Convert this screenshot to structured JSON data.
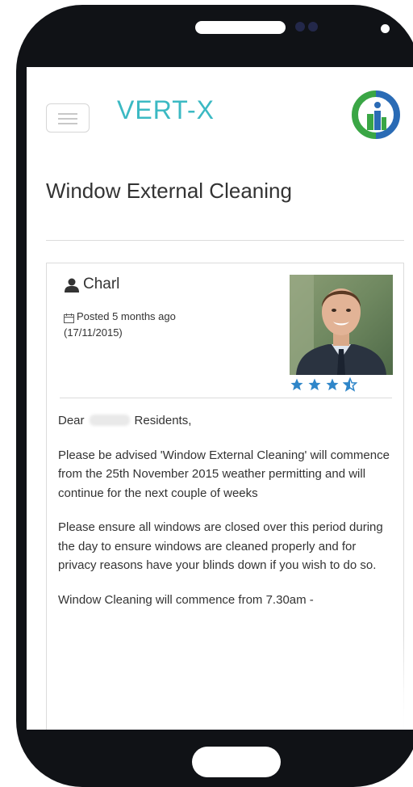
{
  "app": {
    "brand": "VERT-X"
  },
  "page": {
    "title": "Window External Cleaning"
  },
  "post": {
    "author": "Charl",
    "posted": "Posted 5 months ago",
    "posted_date": "(17/11/2015)",
    "rating": 3.5,
    "rating_max": 4,
    "greeting_start": "Dear",
    "greeting_end": "Residents,",
    "paragraph_1": "Please be advised 'Window External Cleaning' will commence from the 25th November 2015 weather permitting and will continue for the next couple of weeks",
    "paragraph_2": "Please ensure all windows are closed over this period during the day to ensure windows are cleaned properly and for privacy reasons have your blinds down if you wish to do so.",
    "paragraph_3": "Window Cleaning will commence from 7.30am -"
  },
  "colors": {
    "brand": "#3bb9c3",
    "star": "#2f86c9",
    "logo_green": "#3aa645",
    "logo_blue": "#2a6bb5"
  },
  "icons": {
    "menu": "hamburger-icon",
    "author": "user-icon",
    "posted": "calendar-icon",
    "rating": "star-icon"
  }
}
